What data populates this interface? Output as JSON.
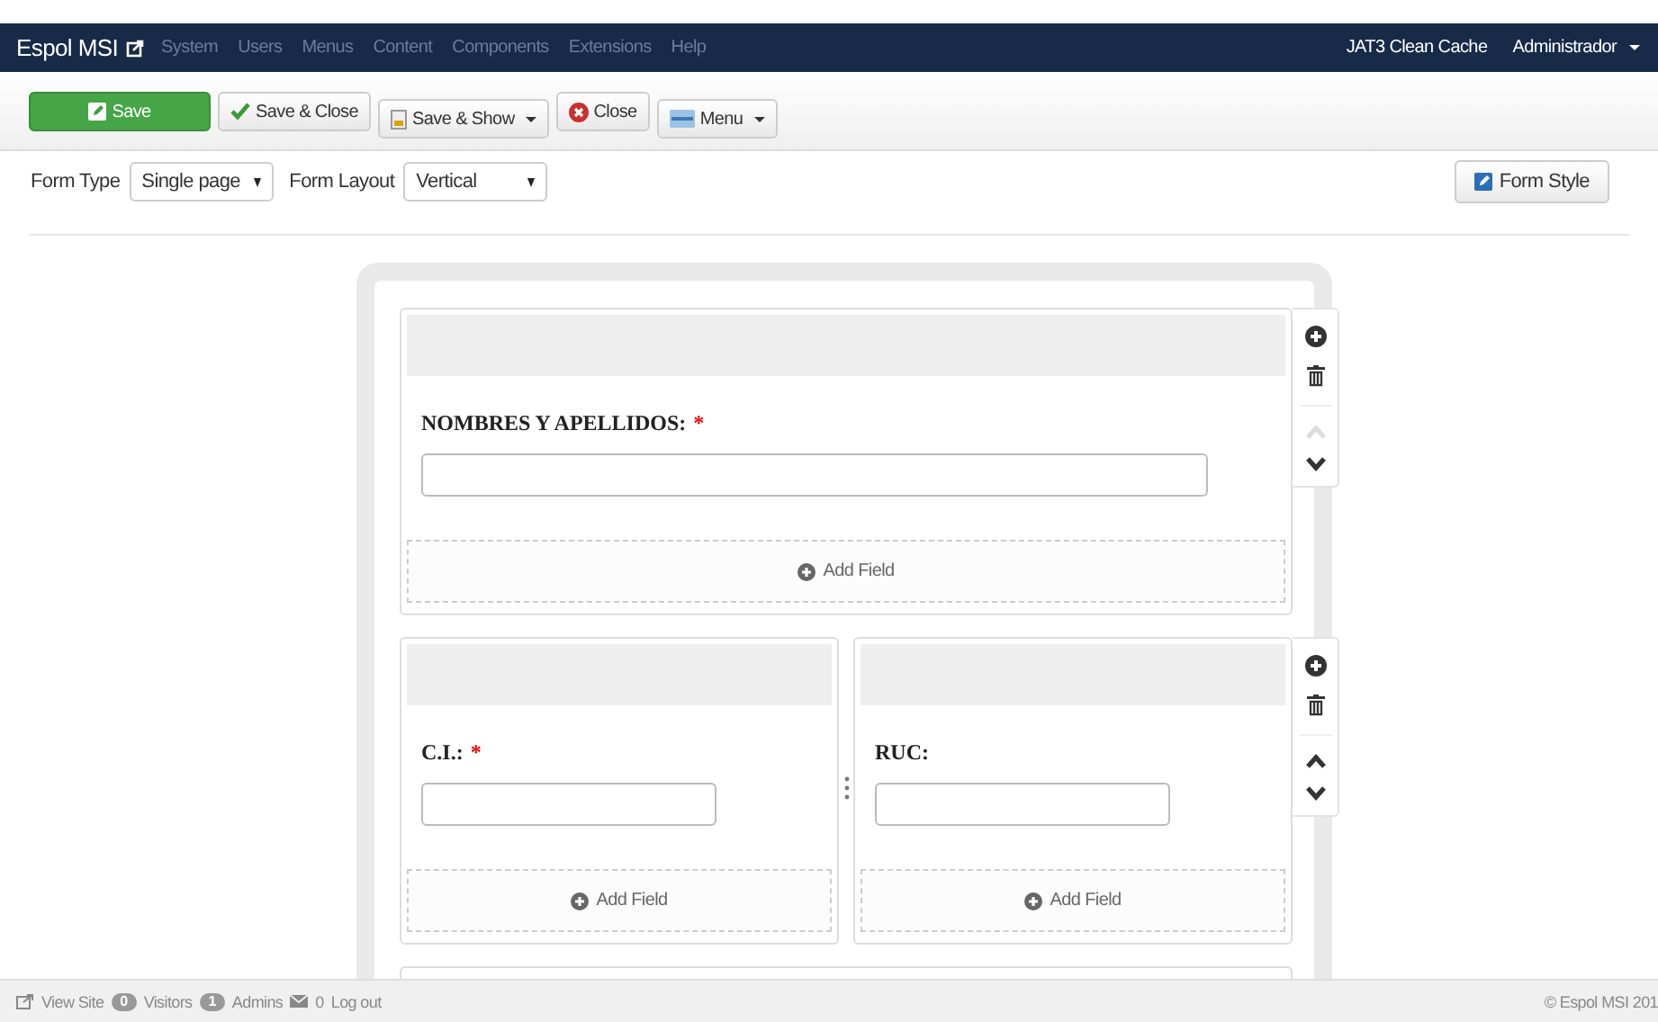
{
  "navbar": {
    "brand": "Espol MSI",
    "menu": [
      "System",
      "Users",
      "Menus",
      "Content",
      "Components",
      "Extensions",
      "Help"
    ],
    "links": [
      "JAT3 Clean Cache"
    ],
    "user": "Administrador"
  },
  "toolbar": [
    {
      "label": "Save",
      "kind": "save",
      "dropdown": false
    },
    {
      "label": "Save & Close",
      "kind": "check",
      "dropdown": false
    },
    {
      "label": "Save & Show",
      "kind": "show",
      "dropdown": true
    },
    {
      "label": "Close",
      "kind": "close",
      "dropdown": false
    },
    {
      "label": "Menu",
      "kind": "menu",
      "dropdown": true
    }
  ],
  "form_options": [
    {
      "label": "Form Type",
      "value": "Single page"
    },
    {
      "label": "Form Layout",
      "value": "Vertical"
    }
  ],
  "form_style_button": "Form Style",
  "rows": [
    {
      "up_enabled": false,
      "columns": [
        {
          "fields": [
            {
              "label": "NOMBRES Y APELLIDOS:",
              "required_mark": "*"
            }
          ],
          "add_field": "Add Field"
        }
      ]
    },
    {
      "up_enabled": true,
      "columns": [
        {
          "fields": [
            {
              "label": "C.I.:",
              "required_mark": "*"
            }
          ],
          "add_field": "Add Field"
        },
        {
          "fields": [
            {
              "label": "RUC:"
            }
          ],
          "add_field": "Add Field"
        }
      ]
    }
  ],
  "footer": {
    "view_site": "View Site",
    "visitors_count": "0",
    "visitors": "Visitors",
    "admins_count": "1",
    "admins": "Admins",
    "messages_count": "0",
    "logout": "Log out",
    "copyright": "© Espol MSI 201"
  }
}
